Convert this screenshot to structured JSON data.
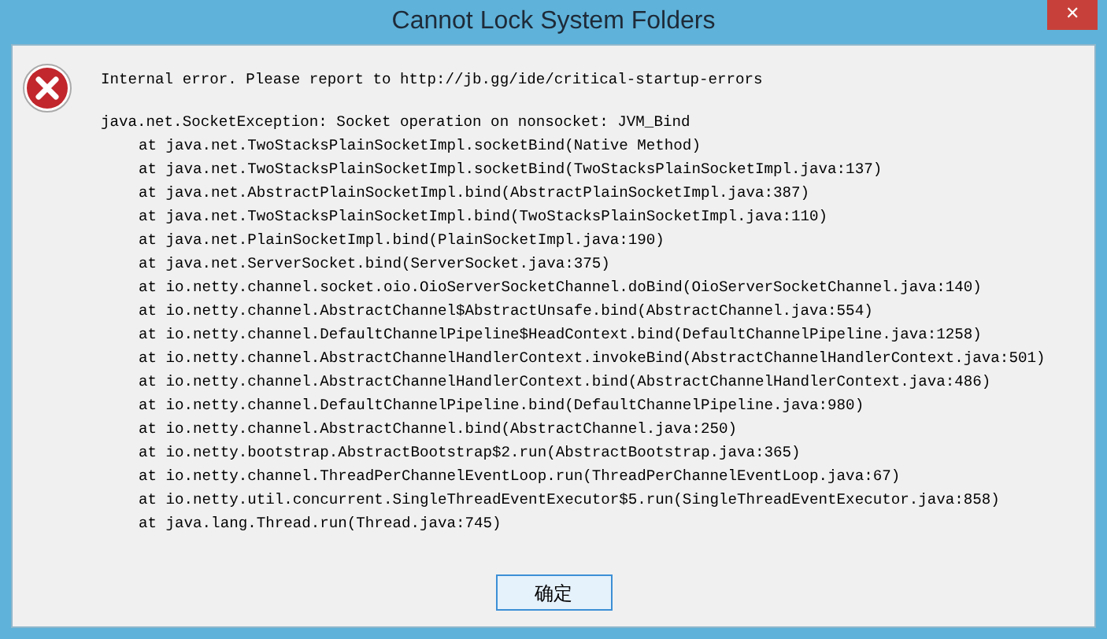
{
  "window": {
    "title": "Cannot Lock System Folders",
    "close": "✕"
  },
  "message": "Internal error. Please report to http://jb.gg/ide/critical-startup-errors",
  "exception": "java.net.SocketException: Socket operation on nonsocket: JVM_Bind",
  "stack_trace": [
    "at java.net.TwoStacksPlainSocketImpl.socketBind(Native Method)",
    "at java.net.TwoStacksPlainSocketImpl.socketBind(TwoStacksPlainSocketImpl.java:137)",
    "at java.net.AbstractPlainSocketImpl.bind(AbstractPlainSocketImpl.java:387)",
    "at java.net.TwoStacksPlainSocketImpl.bind(TwoStacksPlainSocketImpl.java:110)",
    "at java.net.PlainSocketImpl.bind(PlainSocketImpl.java:190)",
    "at java.net.ServerSocket.bind(ServerSocket.java:375)",
    "at io.netty.channel.socket.oio.OioServerSocketChannel.doBind(OioServerSocketChannel.java:140)",
    "at io.netty.channel.AbstractChannel$AbstractUnsafe.bind(AbstractChannel.java:554)",
    "at io.netty.channel.DefaultChannelPipeline$HeadContext.bind(DefaultChannelPipeline.java:1258)",
    "at io.netty.channel.AbstractChannelHandlerContext.invokeBind(AbstractChannelHandlerContext.java:501)",
    "at io.netty.channel.AbstractChannelHandlerContext.bind(AbstractChannelHandlerContext.java:486)",
    "at io.netty.channel.DefaultChannelPipeline.bind(DefaultChannelPipeline.java:980)",
    "at io.netty.channel.AbstractChannel.bind(AbstractChannel.java:250)",
    "at io.netty.bootstrap.AbstractBootstrap$2.run(AbstractBootstrap.java:365)",
    "at io.netty.channel.ThreadPerChannelEventLoop.run(ThreadPerChannelEventLoop.java:67)",
    "at io.netty.util.concurrent.SingleThreadEventExecutor$5.run(SingleThreadEventExecutor.java:858)",
    "at java.lang.Thread.run(Thread.java:745)"
  ],
  "buttons": [
    "确定"
  ]
}
